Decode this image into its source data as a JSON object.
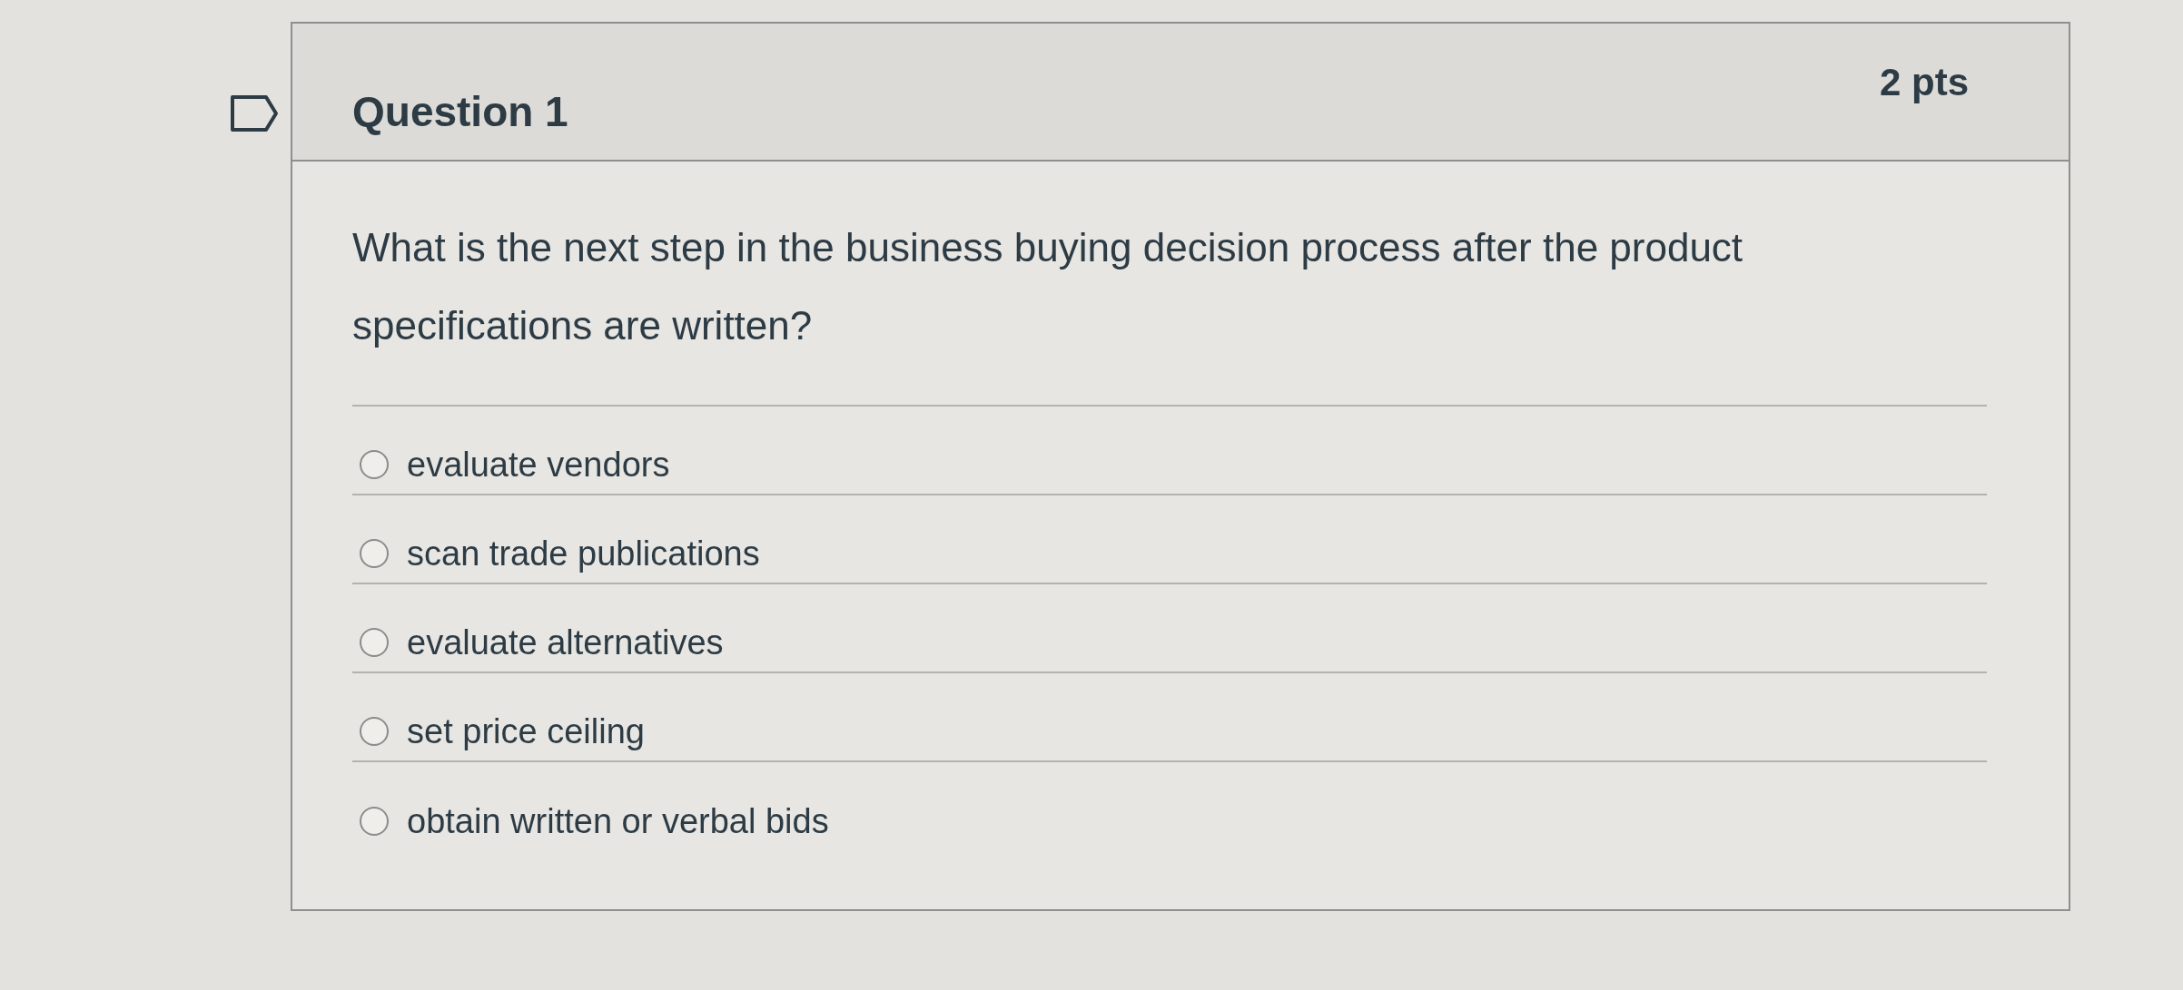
{
  "question": {
    "flagged": false,
    "title": "Question 1",
    "points": "2 pts",
    "text": "What is the next step in the business buying decision process after the product specifications are written?",
    "answers": [
      {
        "label": "evaluate vendors",
        "selected": false
      },
      {
        "label": "scan trade publications",
        "selected": false
      },
      {
        "label": "evaluate alternatives",
        "selected": false
      },
      {
        "label": "set price ceiling",
        "selected": false
      },
      {
        "label": "obtain written or verbal bids",
        "selected": false
      }
    ]
  }
}
